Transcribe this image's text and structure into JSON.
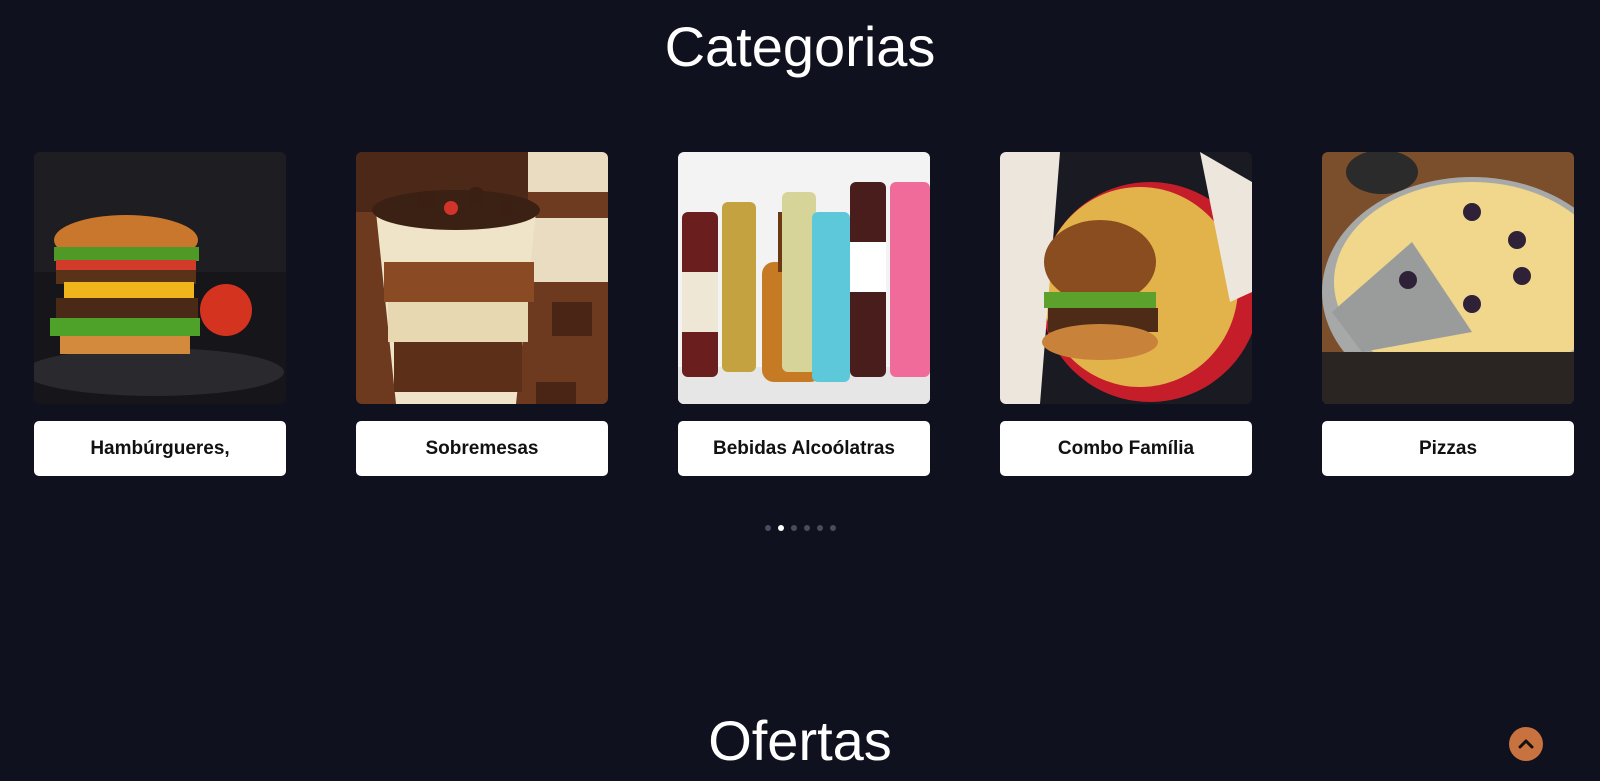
{
  "categories_title": "Categorias",
  "offers_title": "Ofertas",
  "categories": [
    {
      "label": "Hambúrgueres,"
    },
    {
      "label": "Sobremesas"
    },
    {
      "label": "Bebidas Alcoólatras"
    },
    {
      "label": "Combo Família"
    },
    {
      "label": "Pizzas"
    }
  ],
  "carousel": {
    "page_count": 6,
    "active_index": 1
  },
  "colors": {
    "background": "#10111e",
    "accent": "#c8733f",
    "card_label_bg": "#ffffff"
  },
  "icons": {
    "scroll_top": "chevron-up-icon"
  }
}
